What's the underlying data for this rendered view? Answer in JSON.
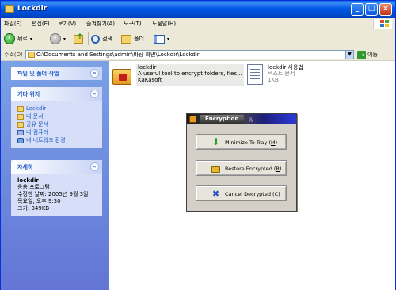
{
  "window": {
    "title": "Lockdir"
  },
  "menu": [
    "파일(F)",
    "편집(E)",
    "보기(V)",
    "즐겨찾기(A)",
    "도구(T)",
    "도움말(H)"
  ],
  "toolbar": {
    "back": "뒤로",
    "search": "검색",
    "folders": "폴더"
  },
  "address": {
    "label": "주소(D)",
    "path": "C:\\Documents and Settings\\admin\\바탕 화면\\Lockdir\\Lockdir",
    "go": "이동"
  },
  "left": {
    "file_tasks": {
      "title": "파일 및 폴더 작업"
    },
    "other_places": {
      "title": "기타 위치",
      "items": [
        "Lockdir",
        "내 문서",
        "공유 문서",
        "내 컴퓨터",
        "내 네트워크 환경"
      ]
    },
    "details": {
      "title": "자세히",
      "name": "lockdir",
      "type": "응용 프로그램",
      "modified": "수정한 날짜: 2005년 9월 3일",
      "time": "목요일, 오후 9:30",
      "size": "크기: 349KB"
    }
  },
  "files": [
    {
      "name": "lockdir",
      "desc": "A useful tool to encrypt folders, fles...",
      "company": "KaKasoft"
    },
    {
      "name": "lockdir 사용법",
      "type": "텍스트 문서",
      "size": "1KB"
    }
  ],
  "dialog": {
    "title": "Encryption",
    "buttons": [
      {
        "label": "Minimize To Tray",
        "key": "M"
      },
      {
        "label": "Restore Encrypted",
        "key": "R"
      },
      {
        "label": "Cancel Decrypted",
        "key": "C"
      }
    ]
  }
}
